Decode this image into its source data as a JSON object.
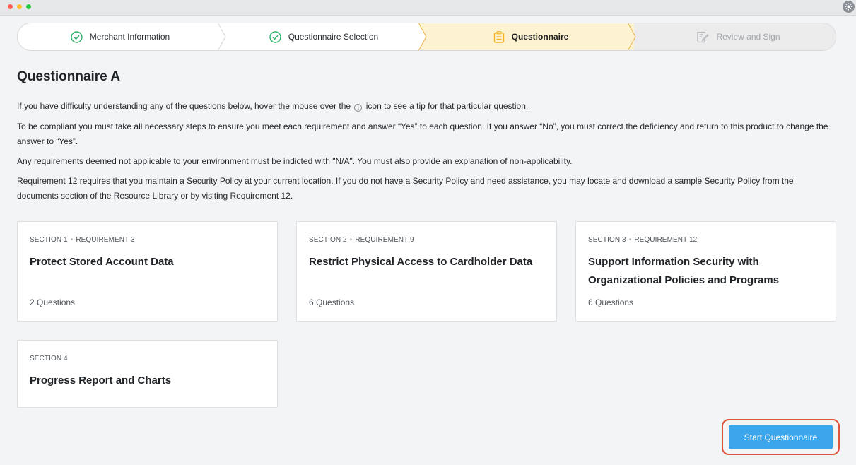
{
  "colors": {
    "accent": "#3ba6ec",
    "highlight_border": "#e0553c",
    "active_step_bg": "#fdf2d2",
    "check_green": "#2fb36a",
    "active_icon": "#f5b324"
  },
  "stepper": {
    "steps": [
      {
        "label": "Merchant Information",
        "state": "complete",
        "icon": "check-circle-icon"
      },
      {
        "label": "Questionnaire Selection",
        "state": "complete",
        "icon": "check-circle-icon"
      },
      {
        "label": "Questionnaire",
        "state": "active",
        "icon": "clipboard-icon"
      },
      {
        "label": "Review and Sign",
        "state": "disabled",
        "icon": "sign-document-icon"
      }
    ]
  },
  "main": {
    "title": "Questionnaire A",
    "intro_before_icon": "If you have difficulty understanding any of the questions below, hover the mouse over the",
    "intro_after_icon": "icon to see a tip for that particular question.",
    "compliance": "To be compliant you must take all necessary steps to ensure you meet each requirement and answer “Yes” to each question. If you answer “No”, you must correct the deficiency and return to this product to change the answer to “Yes”.",
    "not_applicable": "Any requirements deemed not applicable to your environment must be indicted with \"N/A\". You must also provide an explanation of non-applicability.",
    "requirement12": "Requirement 12 requires that you maintain a Security Policy at your current location. If you do not have a Security Policy and need assistance, you may locate and download a sample Security Policy from the documents section of the Resource Library or by visiting Requirement 12."
  },
  "sections": [
    {
      "section": "SECTION 1",
      "requirement": "REQUIREMENT 3",
      "title": "Protect Stored Account Data",
      "count": "2 Questions"
    },
    {
      "section": "SECTION 2",
      "requirement": "REQUIREMENT 9",
      "title": "Restrict Physical Access to Cardholder Data",
      "count": "6 Questions"
    },
    {
      "section": "SECTION 3",
      "requirement": "REQUIREMENT 12",
      "title": "Support Information Security with Organizational Policies and Programs",
      "count": "6 Questions"
    },
    {
      "section": "SECTION 4",
      "title": "Progress Report and Charts"
    }
  ],
  "actions": {
    "start_label": "Start Questionnaire"
  }
}
